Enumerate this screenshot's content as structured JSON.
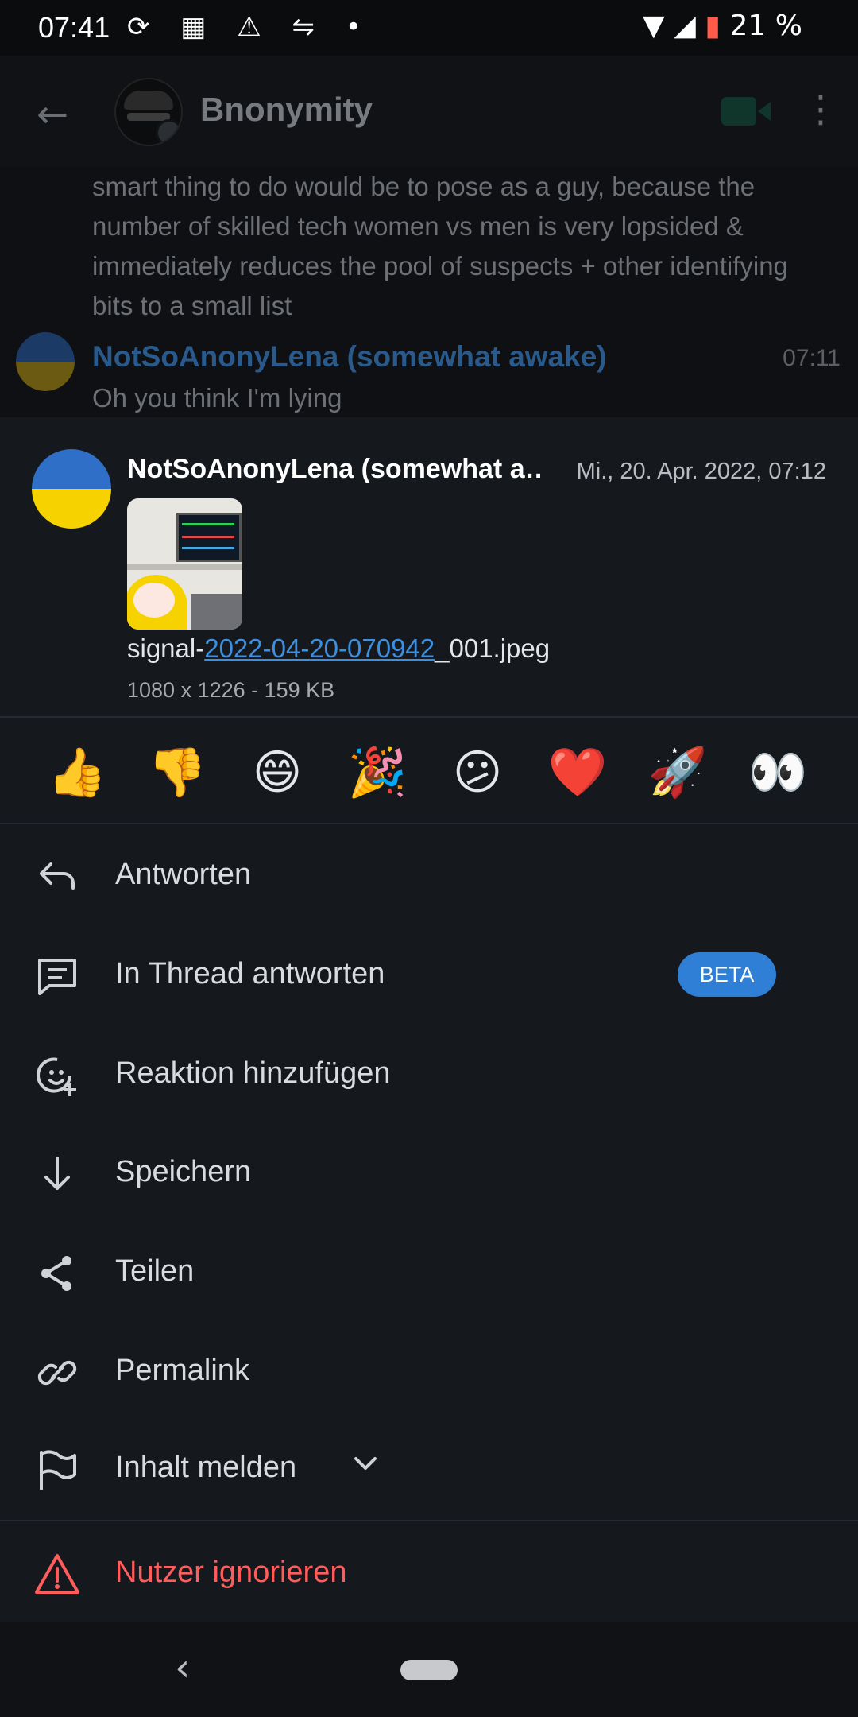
{
  "status_bar": {
    "time": "07:41",
    "notification_icons": "⟳ ▦ ⚠ ⇋ •",
    "battery_percent": "21 %"
  },
  "room": {
    "name": "Bnonymity"
  },
  "timeline": {
    "previous_message_text": "smart thing to do would be to pose as a guy, because the number of skilled tech women vs men is very lopsided & immediately reduces the pool of suspects + other identifying bits to a small list",
    "last_sender": "NotSoAnonyLena (somewhat awake)",
    "last_time": "07:11",
    "last_message": "Oh you think I'm lying"
  },
  "sheet": {
    "preview": {
      "sender": "NotSoAnonyLena (somewhat a…",
      "date": "Mi., 20. Apr. 2022, 07:12",
      "file_prefix": "signal-",
      "file_link": "2022-04-20-070942",
      "file_suffix": "_001.jpeg",
      "file_meta": "1080 x 1226 - 159 KB"
    },
    "reactions": [
      "👍",
      "👎",
      "😄",
      "🎉",
      "😕",
      "❤️",
      "🚀",
      "👀"
    ],
    "actions": {
      "reply": "Antworten",
      "reply_thread": "In Thread antworten",
      "beta_badge": "BETA",
      "add_reaction": "Reaktion hinzufügen",
      "save": "Speichern",
      "share": "Teilen",
      "permalink": "Permalink",
      "report": "Inhalt melden",
      "ignore_user": "Nutzer ignorieren"
    }
  },
  "colors": {
    "accent": "#2f7fd6",
    "danger": "#ff5c5c",
    "sheet_background": "#15191e"
  }
}
